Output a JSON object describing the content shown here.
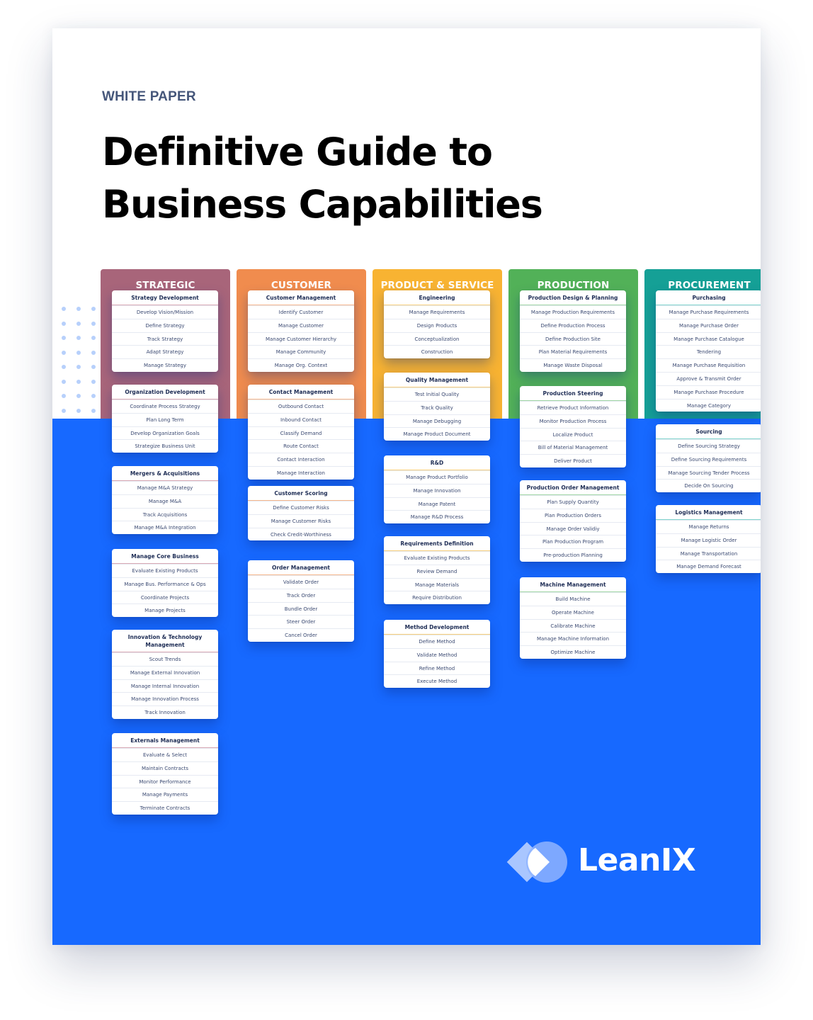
{
  "document": {
    "eyebrow": "WHITE PAPER",
    "title_lines": [
      "Definitive Guide to",
      "Business Capabilities"
    ],
    "logo_text": "LeanIX"
  },
  "colors": {
    "strategic": "#a8657a",
    "customer": "#f08c4e",
    "product": "#f8b332",
    "production": "#52b158",
    "procurement": "#15a096",
    "blue_background": "#1769ff"
  },
  "columns": [
    {
      "title": "STRATEGIC\nMANAGEMENT",
      "accent_line": "#d9a8b3",
      "cards": [
        {
          "title": "Strategy Development",
          "items": [
            "Develop Vision/Mission",
            "Define Strategy",
            "Track Strategy",
            "Adapt Strategy",
            "Manage Strategy"
          ]
        },
        {
          "title": "Organization Development",
          "items": [
            "Coordinate Process Strategy",
            "Plan Long Term",
            "Develop Organization Goals",
            "Strategize Business Unit"
          ]
        },
        {
          "title": "Mergers & Acquisitions",
          "items": [
            "Manage M&A Strategy",
            "Manage M&A",
            "Track Acquisitions",
            "Manage M&A Integration"
          ]
        },
        {
          "title": "Manage Core Business",
          "items": [
            "Evaluate Existing Products",
            "Manage Bus. Performance & Ops",
            "Coordinate Projects",
            "Manage Projects"
          ]
        },
        {
          "title": "Innovation & Technology\nManagement",
          "items": [
            "Scout Trends",
            "Manage External Innovation",
            "Manage Internal Innovation",
            "Manage Innovation Process",
            "Track Innovation"
          ]
        },
        {
          "title": "Externals Management",
          "items": [
            "Evaluate & Select",
            "Maintain Contracts",
            "Monitor Performance",
            "Manage Payments",
            "Terminate Contracts"
          ]
        }
      ]
    },
    {
      "title": "CUSTOMER\nRELATIONSHIPS",
      "accent_line": "#f6b58a",
      "cards": [
        {
          "title": "Customer Management",
          "items": [
            "Identify Customer",
            "Manage Customer",
            "Manage Customer Hierarchy",
            "Manage Community",
            "Manage Org. Context"
          ]
        },
        {
          "title": "Contact Management",
          "items": [
            "Outbound Contact",
            "Inbound Contact",
            "Classify Demand",
            "Route Contact",
            "Contact Interaction",
            "Manage Interaction"
          ]
        },
        {
          "title": "Customer Scoring",
          "items": [
            "Define Customer Risks",
            "Manage Customer Risks",
            "Check Credit-Worthiness"
          ]
        },
        {
          "title": "Order Management",
          "items": [
            "Validate Order",
            "Track Order",
            "Bundle Order",
            "Steer Order",
            "Cancel Order"
          ]
        }
      ]
    },
    {
      "title": "PRODUCT & SERVICE\nDEVELOPMENT",
      "accent_line": "#f8cf7a",
      "cards": [
        {
          "title": "Engineering",
          "items": [
            "Manage Requirements",
            "Design Products",
            "Conceptualization",
            "Construction"
          ]
        },
        {
          "title": "Quality Management",
          "items": [
            "Test Initial Quality",
            "Track Quality",
            "Manage Debugging",
            "Manage Product Document"
          ]
        },
        {
          "title": "R&D",
          "items": [
            "Manage Product Portfolio",
            "Manage Innovation",
            "Manage Patent",
            "Manage R&D Process"
          ]
        },
        {
          "title": "Requirements Definition",
          "items": [
            "Evaluate Existing Products",
            "Review Demand",
            "Manage Materials",
            "Require Distribution"
          ]
        },
        {
          "title": "Method Development",
          "items": [
            "Define Method",
            "Validate Method",
            "Refine Method",
            "Execute Method"
          ]
        }
      ]
    },
    {
      "title": "PRODUCTION",
      "accent_line": "#9fd6a3",
      "cards": [
        {
          "title": "Production Design & Planning",
          "items": [
            "Manage Production Requirements",
            "Define Production Process",
            "Define Production Site",
            "Plan Material Requirements",
            "Manage Waste Disposal"
          ]
        },
        {
          "title": "Production Steering",
          "items": [
            "Retrieve Product Information",
            "Monitor Production Process",
            "Localize Product",
            "Bill of Material Management",
            "Deliver Product"
          ]
        },
        {
          "title": "Production Order Management",
          "items": [
            "Plan Supply Quantity",
            "Plan Production Orders",
            "Manage Order Validiy",
            "Plan Production Program",
            "Pre-production Planning"
          ]
        },
        {
          "title": "Machine Management",
          "items": [
            "Build Machine",
            "Operate Machine",
            "Calibrate Machine",
            "Manage Machine Information",
            "Optimize Machine"
          ]
        }
      ]
    },
    {
      "title": "PROCUREMENT\n& LOGISTICS",
      "accent_line": "#7fd3cc",
      "cards": [
        {
          "title": "Purchasing",
          "items": [
            "Manage Purchase Requirements",
            "Manage Purchase Order",
            "Manage Purchase Catalogue",
            "Tendering",
            "Manage Purchase Requisition",
            "Approve & Transmit Order",
            "Manage Purchase Procedure",
            "Manage Category"
          ]
        },
        {
          "title": "Sourcing",
          "items": [
            "Define Sourcing Strategy",
            "Define Sourcing Requirements",
            "Manage Sourcing Tender Process",
            "Decide On Sourcing"
          ]
        },
        {
          "title": "Logistics Management",
          "items": [
            "Manage Returns",
            "Manage Logistic Order",
            "Manage Transportation",
            "Manage Demand Forecast"
          ]
        }
      ]
    }
  ]
}
